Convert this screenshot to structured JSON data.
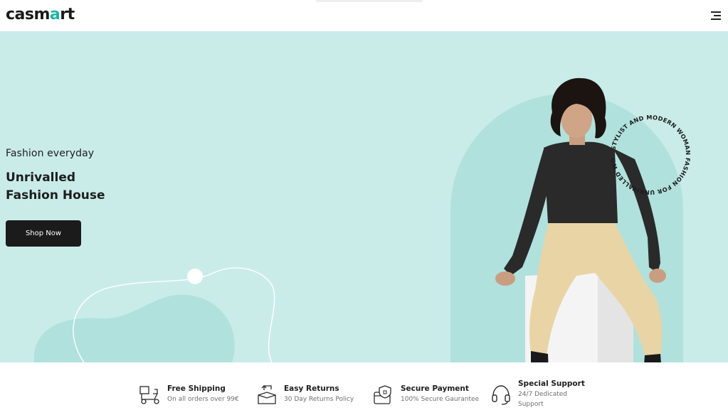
{
  "brand": {
    "name_prefix": "casm",
    "name_accent": "a",
    "name_suffix": "rt",
    "accent_color": "#19b6a6"
  },
  "header": {
    "menu_icon": "hamburger-menu-icon"
  },
  "hero": {
    "eyebrow": "Fashion everyday",
    "headline_line1": "Unrivalled",
    "headline_line2": "Fashion House",
    "cta_label": "Shop Now",
    "circular_text": "STYLIST AND MODERN WOMAN FASHION FOR UNRIVALLED WOMAN",
    "background_color": "#c9ece9",
    "arch_color": "#b0e1dd"
  },
  "features": [
    {
      "icon": "scooter-delivery-icon",
      "title": "Free Shipping",
      "desc": "On all orders over 99€"
    },
    {
      "icon": "return-box-icon",
      "title": "Easy Returns",
      "desc": "30 Day Returns Policy"
    },
    {
      "icon": "secure-card-icon",
      "title": "Secure Payment",
      "desc": "100% Secure Gaurantee"
    },
    {
      "icon": "headset-icon",
      "title": "Special Support",
      "desc_line1": "24/7 Dedicated",
      "desc_line2": "Support"
    }
  ]
}
